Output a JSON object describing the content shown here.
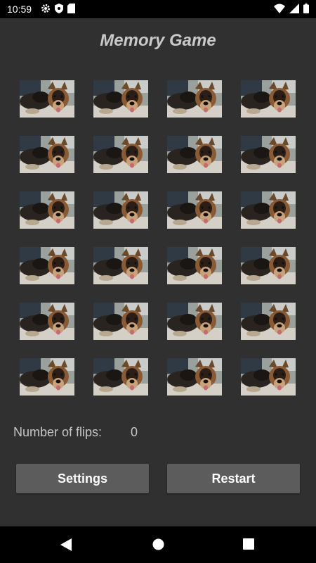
{
  "status_bar": {
    "time": "10:59",
    "left_icons": [
      "gear-icon",
      "shield-icon",
      "sd-card-icon"
    ],
    "right_icons": [
      "wifi-icon",
      "signal-icon",
      "battery-icon"
    ]
  },
  "title": "Memory Game",
  "cards": {
    "rows": 6,
    "columns": 4,
    "count": 24,
    "face": "dog-photo"
  },
  "flips": {
    "label": "Number of flips:",
    "value": "0"
  },
  "buttons": {
    "settings": "Settings",
    "restart": "Restart"
  },
  "nav_bar": [
    "back-icon",
    "home-icon",
    "recents-icon"
  ],
  "colors": {
    "background": "#303030",
    "title": "#c9c9c9",
    "button": "#5c5c5c"
  }
}
